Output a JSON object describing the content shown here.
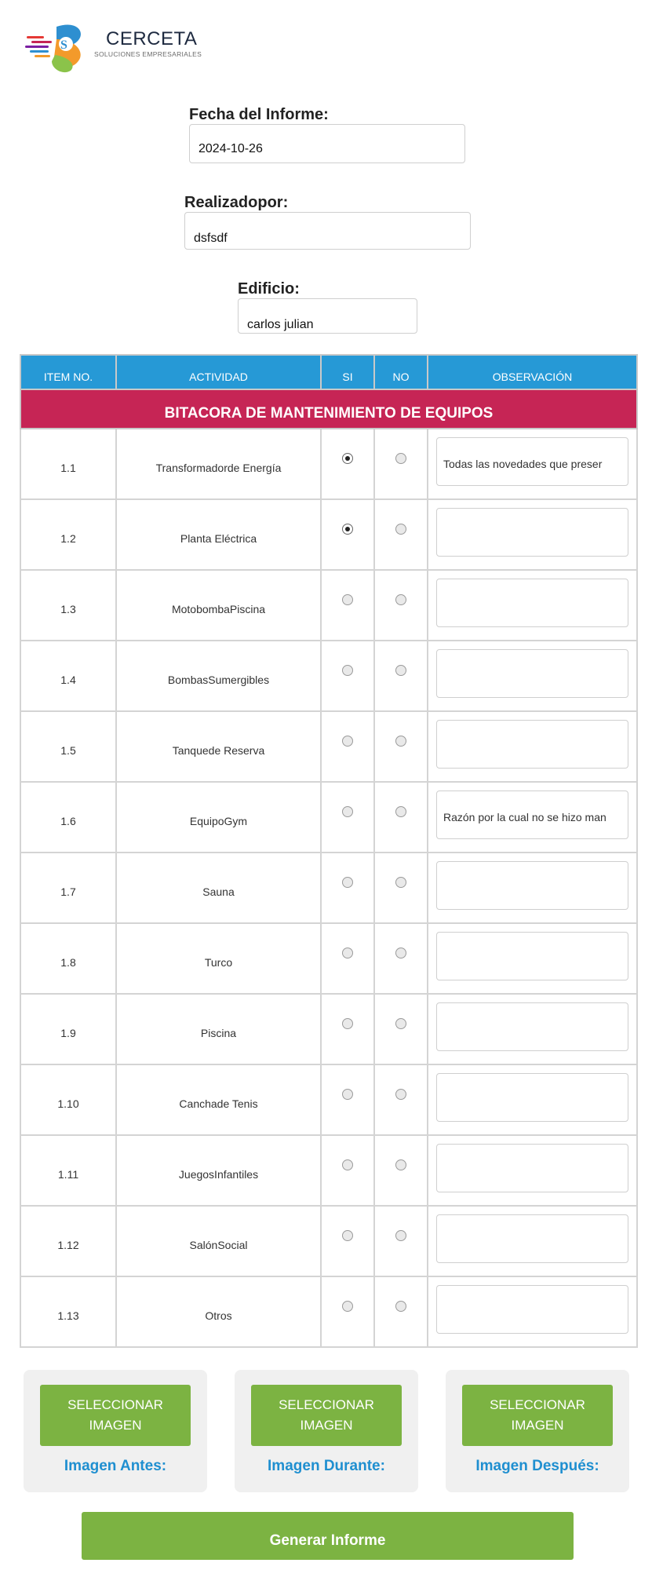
{
  "brand": {
    "name": "CERCETA",
    "tagline": "SOLUCIONES EMPRESARIALES",
    "colors": {
      "primary": "#2699d6",
      "banner": "#c62555",
      "button": "#7cb342"
    }
  },
  "form": {
    "fecha_label": "Fecha del Informe:",
    "fecha_value": "2024-10-26",
    "realizado_label": "Realizadopor:",
    "realizado_value": "dsfsdf",
    "edificio_label": "Edificio:",
    "edificio_value": "carlos julian"
  },
  "table": {
    "headers": [
      "ITEM NO.",
      "ACTIVIDAD",
      "SI",
      "NO",
      "OBSERVACIÓN"
    ],
    "title": "BITACORA DE MANTENIMIENTO DE EQUIPOS",
    "rows": [
      {
        "item": "1.1",
        "actividad": "Transformadorde Energía",
        "si": true,
        "no": false,
        "observacion": "Todas las novedades que preser"
      },
      {
        "item": "1.2",
        "actividad": "Planta Eléctrica",
        "si": true,
        "no": false,
        "observacion": ""
      },
      {
        "item": "1.3",
        "actividad": "MotobombaPiscina",
        "si": false,
        "no": false,
        "observacion": ""
      },
      {
        "item": "1.4",
        "actividad": "BombasSumergibles",
        "si": false,
        "no": false,
        "observacion": ""
      },
      {
        "item": "1.5",
        "actividad": "Tanquede Reserva",
        "si": false,
        "no": false,
        "observacion": ""
      },
      {
        "item": "1.6",
        "actividad": "EquipoGym",
        "si": false,
        "no": false,
        "observacion": "Razón por la cual no se hizo man"
      },
      {
        "item": "1.7",
        "actividad": "Sauna",
        "si": false,
        "no": false,
        "observacion": ""
      },
      {
        "item": "1.8",
        "actividad": "Turco",
        "si": false,
        "no": false,
        "observacion": ""
      },
      {
        "item": "1.9",
        "actividad": "Piscina",
        "si": false,
        "no": false,
        "observacion": ""
      },
      {
        "item": "1.10",
        "actividad": "Canchade Tenis",
        "si": false,
        "no": false,
        "observacion": ""
      },
      {
        "item": "1.11",
        "actividad": "JuegosInfantiles",
        "si": false,
        "no": false,
        "observacion": ""
      },
      {
        "item": "1.12",
        "actividad": "SalónSocial",
        "si": false,
        "no": false,
        "observacion": ""
      },
      {
        "item": "1.13",
        "actividad": "Otros",
        "si": false,
        "no": false,
        "observacion": ""
      }
    ]
  },
  "images": [
    {
      "button_line1": "SELECCIONAR",
      "button_line2": "IMAGEN",
      "label": "Imagen Antes:"
    },
    {
      "button_line1": "SELECCIONAR",
      "button_line2": "IMAGEN",
      "label": "Imagen Durante:"
    },
    {
      "button_line1": "SELECCIONAR",
      "button_line2": "IMAGEN",
      "label": "Imagen Después:"
    }
  ],
  "generate_label": "Generar Informe"
}
